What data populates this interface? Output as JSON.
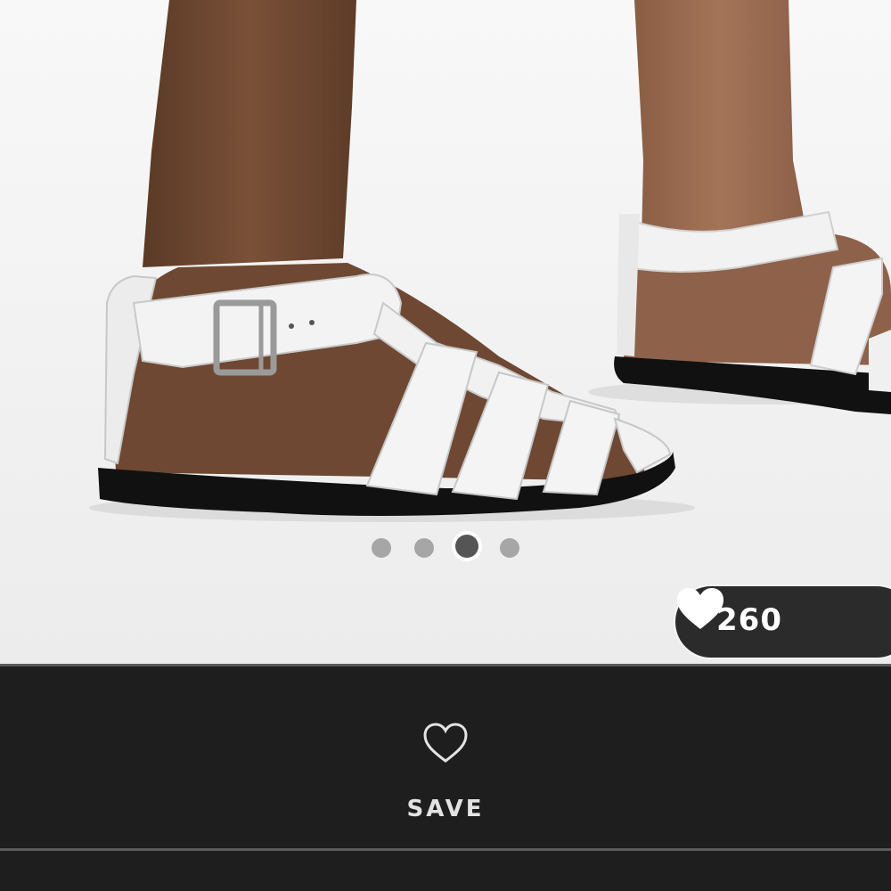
{
  "product_image": {
    "alt_icon": "white-leather-fisherman-sandal-photo",
    "carousel": {
      "total": 4,
      "active_index": 2
    }
  },
  "likes": {
    "count": "260",
    "icon": "heart-filled-icon"
  },
  "save": {
    "label": "SAVE",
    "icon": "heart-outline-icon"
  },
  "colors": {
    "background_dark": "#1e1e1e",
    "pill_background": "#2b2b2b",
    "text_light": "#e3e3e3",
    "dot_inactive": "#a6a6a6",
    "dot_active": "#555555"
  }
}
